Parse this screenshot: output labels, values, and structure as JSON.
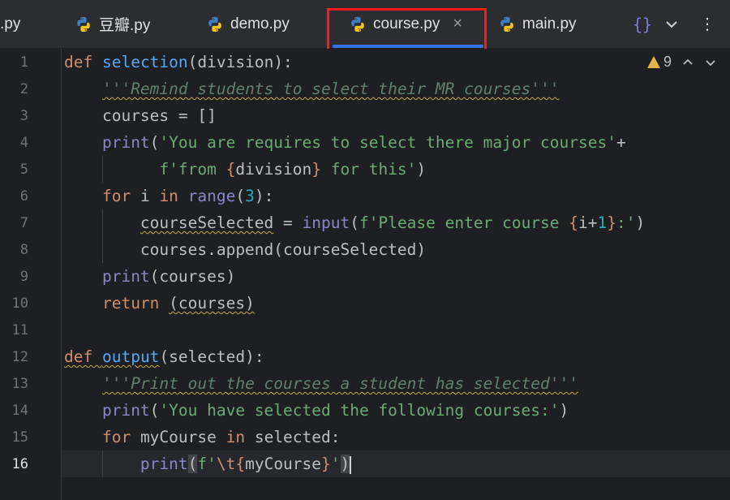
{
  "tabs": [
    {
      "label": ".py"
    },
    {
      "label": "豆瓣.py"
    },
    {
      "label": "demo.py"
    },
    {
      "label": "course.py",
      "close": "×"
    },
    {
      "label": "main.py"
    }
  ],
  "toolbar": {
    "braces": "{}",
    "dropdown": "⌄",
    "more": "⋮"
  },
  "inspections": {
    "warnings_count": "9"
  },
  "line_numbers": [
    "1",
    "2",
    "3",
    "4",
    "5",
    "6",
    "7",
    "8",
    "9",
    "10",
    "11",
    "12",
    "13",
    "14",
    "15",
    "16"
  ],
  "current_line": "16",
  "colors": {
    "keyword": "#cf8e6d",
    "function": "#56a8f5",
    "string": "#6aab73",
    "docstring": "#5f826b",
    "number": "#2aacb8",
    "accent": "#3574f0",
    "highlight_box": "#ff1a1a"
  },
  "code": {
    "l1": {
      "kw": "def",
      "name": "selection",
      "rest": "(division):"
    },
    "l2": {
      "doc": "'''Remind students to select their MR courses'''"
    },
    "l3": {
      "text": "courses = []"
    },
    "l4": {
      "fn": "print",
      "open": "(",
      "str": "'You are requires to select there major courses'",
      "plus": "+"
    },
    "l5": {
      "s1": "f'from ",
      "b1": "{",
      "var": "division",
      "b2": "}",
      "s2": " for this'",
      "close": ")"
    },
    "l6": {
      "kw": "for",
      "mid": " i ",
      "kw2": "in",
      "sp": " ",
      "fn": "range",
      "open": "(",
      "num": "3",
      "close": "):"
    },
    "l7": {
      "var": "courseSelected",
      "eq": " = ",
      "fn": "input",
      "open": "(",
      "s1": "f'Please enter course ",
      "b1": "{",
      "expr": "i+",
      "num": "1",
      "b2": "}",
      "s2": ":'",
      "close": ")"
    },
    "l8": {
      "text": "courses.append(courseSelected)"
    },
    "l9": {
      "fn": "print",
      "rest": "(courses)"
    },
    "l10": {
      "kw": "return",
      "sp": " ",
      "rest": "(courses)"
    },
    "l12": {
      "kw": "def",
      "name": "output",
      "rest": "(selected):"
    },
    "l13": {
      "doc": "'''Print out the courses a student has selected'''"
    },
    "l14": {
      "fn": "print",
      "open": "(",
      "str": "'You have selected the following courses:'",
      "close": ")"
    },
    "l15": {
      "kw": "for",
      "mid": " myCourse ",
      "kw2": "in",
      "rest": " selected:"
    },
    "l16": {
      "fn": "print",
      "open": "(",
      "s1": "f'",
      "esc": "\\t",
      "b1": "{",
      "var": "myCourse",
      "b2": "}",
      "s2": "'",
      "close": ")"
    }
  }
}
